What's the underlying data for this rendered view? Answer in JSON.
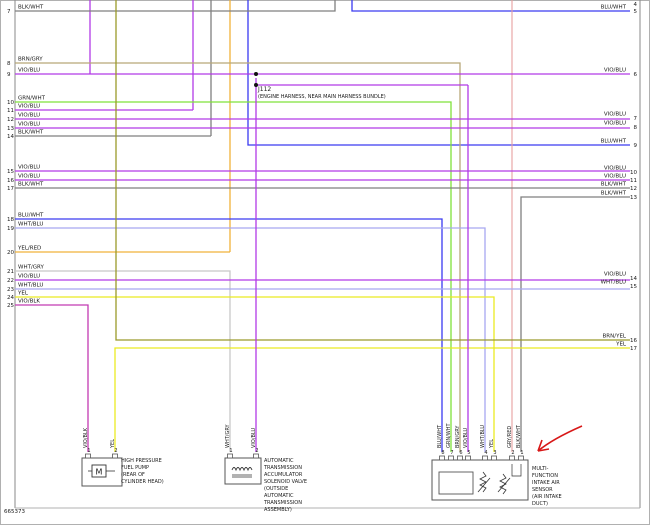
{
  "diagram_id": "665373",
  "connector_label": "J112",
  "connector_note": "(ENGINE HARNESS, NEAR MAIN HARNESS BUNDLE)",
  "colors": {
    "BLK/WHT": "#7f7f7f",
    "BLU/WHT": "#3a3af0",
    "BRN/GRY": "#b8a878",
    "VIO/BLU": "#b23ae6",
    "GRN/WHT": "#7fe23a",
    "YEL/RED": "#f0b23a",
    "WHT/GRY": "#c8c8c8",
    "WHT/BLU": "#a8a8f0",
    "YEL": "#eaea22",
    "VIO/BLK": "#c23ab2",
    "BRN/YEL": "#9a9a2a",
    "GRY/RED": "#e8a0a0",
    "annotation": "#d81818"
  },
  "left_pins": [
    {
      "pin": "6",
      "wire": ""
    },
    {
      "pin": "7",
      "wire": "BLK/WHT"
    },
    {
      "pin": "8",
      "wire": "BRN/GRY"
    },
    {
      "pin": "9",
      "wire": "VIO/BLU"
    },
    {
      "pin": "10",
      "wire": "GRN/WHT"
    },
    {
      "pin": "11",
      "wire": "VIO/BLU"
    },
    {
      "pin": "12",
      "wire": "VIO/BLU"
    },
    {
      "pin": "13",
      "wire": "VIO/BLU"
    },
    {
      "pin": "14",
      "wire": "BLK/WHT"
    },
    {
      "pin": "15",
      "wire": "VIO/BLU"
    },
    {
      "pin": "16",
      "wire": "VIO/BLU"
    },
    {
      "pin": "17",
      "wire": "BLK/WHT"
    },
    {
      "pin": "18",
      "wire": "BLU/WHT"
    },
    {
      "pin": "19",
      "wire": "WHT/BLU"
    },
    {
      "pin": "20",
      "wire": "YEL/RED"
    },
    {
      "pin": "21",
      "wire": "WHT/GRY"
    },
    {
      "pin": "22",
      "wire": "VIO/BLU"
    },
    {
      "pin": "23",
      "wire": "WHT/BLU"
    },
    {
      "pin": "24",
      "wire": "YEL"
    },
    {
      "pin": "25",
      "wire": "VIO/BLK"
    }
  ],
  "right_pins": [
    {
      "pin": "4",
      "wire": ""
    },
    {
      "pin": "5",
      "wire": "BLU/WHT"
    },
    {
      "pin": "6",
      "wire": "VIO/BLU"
    },
    {
      "pin": "7",
      "wire": "VIO/BLU"
    },
    {
      "pin": "8",
      "wire": "VIO/BLU"
    },
    {
      "pin": "9",
      "wire": "BLU/WHT"
    },
    {
      "pin": "10",
      "wire": "VIO/BLU"
    },
    {
      "pin": "11",
      "wire": "VIO/BLU"
    },
    {
      "pin": "12",
      "wire": "BLK/WHT"
    },
    {
      "pin": "13",
      "wire": "BLK/WHT"
    },
    {
      "pin": "14",
      "wire": "VIO/BLU"
    },
    {
      "pin": "15",
      "wire": "WHT/BLU"
    },
    {
      "pin": "16",
      "wire": "BRN/YEL"
    },
    {
      "pin": "17",
      "wire": "YEL"
    }
  ],
  "components": [
    {
      "name_lines": [
        "HIGH PRESSURE",
        "FUEL PUMP",
        "(REAR OF",
        "CYLINDER HEAD)"
      ],
      "pins": [
        "1",
        "2"
      ],
      "wires": [
        "VIO/BLK",
        "YEL"
      ],
      "symbol": "M"
    },
    {
      "name_lines": [
        "AUTOMATIC",
        "TRANSMISSION",
        "ACCUMULATOR",
        "SOLENOID VALVE",
        "(OUTSIDE",
        "AUTOMATIC",
        "TRANSMISSION",
        "ASSEMBLY)"
      ],
      "pins": [
        "1",
        "2"
      ],
      "wires": [
        "WHT/GRY",
        "VIO/BLU"
      ]
    },
    {
      "name_lines": [
        "MULTI-",
        "FUNCTION",
        "INTAKE AIR",
        "SENSOR",
        "(AIR INTAKE",
        "DUCT)"
      ],
      "pins": [
        "8",
        "7",
        "6",
        "5",
        "4",
        "3",
        "2",
        "1"
      ],
      "wires": [
        "BLU/WHT",
        "GRN/WHT",
        "BRN/GRY",
        "VIO/BLU",
        "WHT/BLU",
        "YEL",
        "GRY/RED",
        "BLK/WHT"
      ]
    }
  ]
}
